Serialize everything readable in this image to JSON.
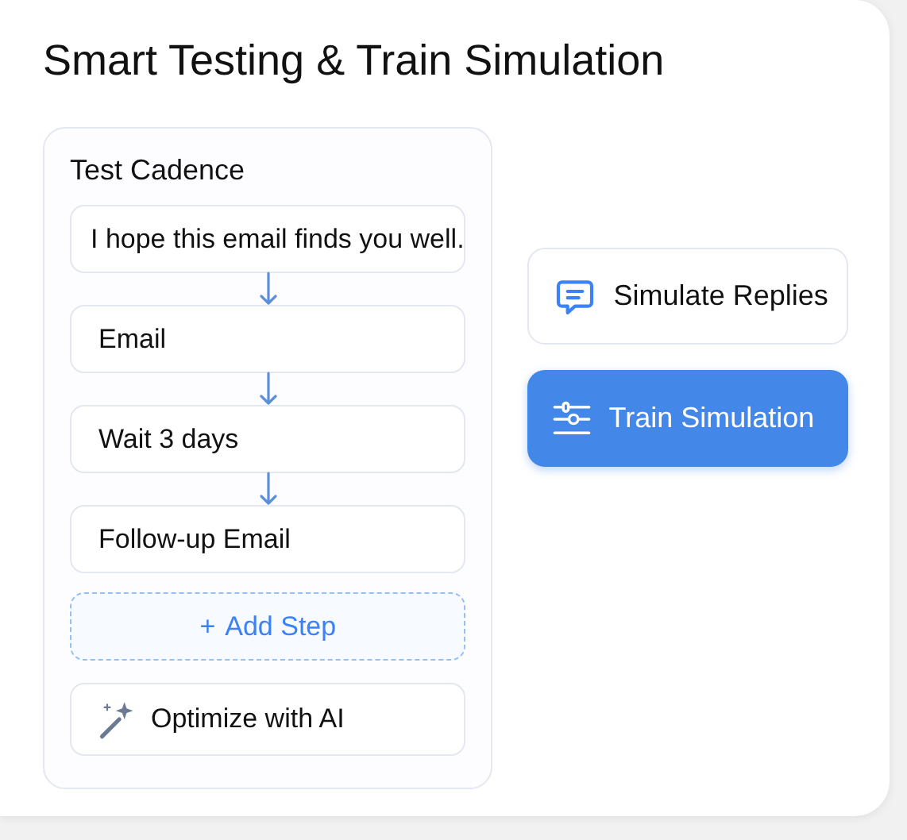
{
  "title": "Smart Testing & Train Simulation",
  "cadence": {
    "heading": "Test Cadence",
    "steps": [
      {
        "label": "I hope this email finds you well."
      },
      {
        "label": "Email"
      },
      {
        "label": "Wait 3 days"
      },
      {
        "label": "Follow-up Email"
      }
    ],
    "add_step": {
      "icon": "+",
      "label": "Add Step"
    },
    "optimize": {
      "label": "Optimize with AI"
    }
  },
  "actions": [
    {
      "label": "Simulate Replies",
      "kind": "secondary"
    },
    {
      "label": "Train Simulation",
      "kind": "primary"
    }
  ]
}
